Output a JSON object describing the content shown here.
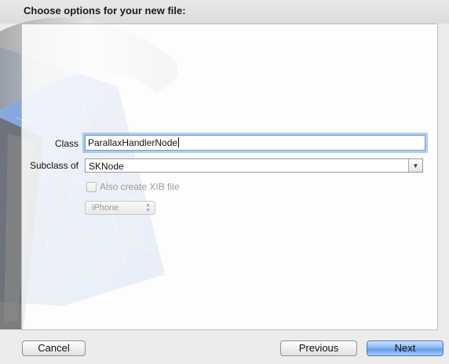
{
  "header": {
    "title": "Choose options for your new file:"
  },
  "form": {
    "class_label": "Class",
    "class_value": "ParallaxHandlerNode",
    "subclass_label": "Subclass of",
    "subclass_value": "SKNode",
    "xib_checkbox_label": "Also create XIB file",
    "xib_checked": false,
    "device_value": "iPhone"
  },
  "buttons": {
    "cancel": "Cancel",
    "previous": "Previous",
    "next": "Next"
  },
  "colors": {
    "focus_ring": "#78a5e6",
    "primary_button": "#5f98e8",
    "blueprint": "#3f74c8"
  },
  "icons": {
    "artwork": "hammer-blueprint-icon",
    "combo_arrow": "chevron-down-icon",
    "popup_arrows": "up-down-arrows-icon"
  }
}
